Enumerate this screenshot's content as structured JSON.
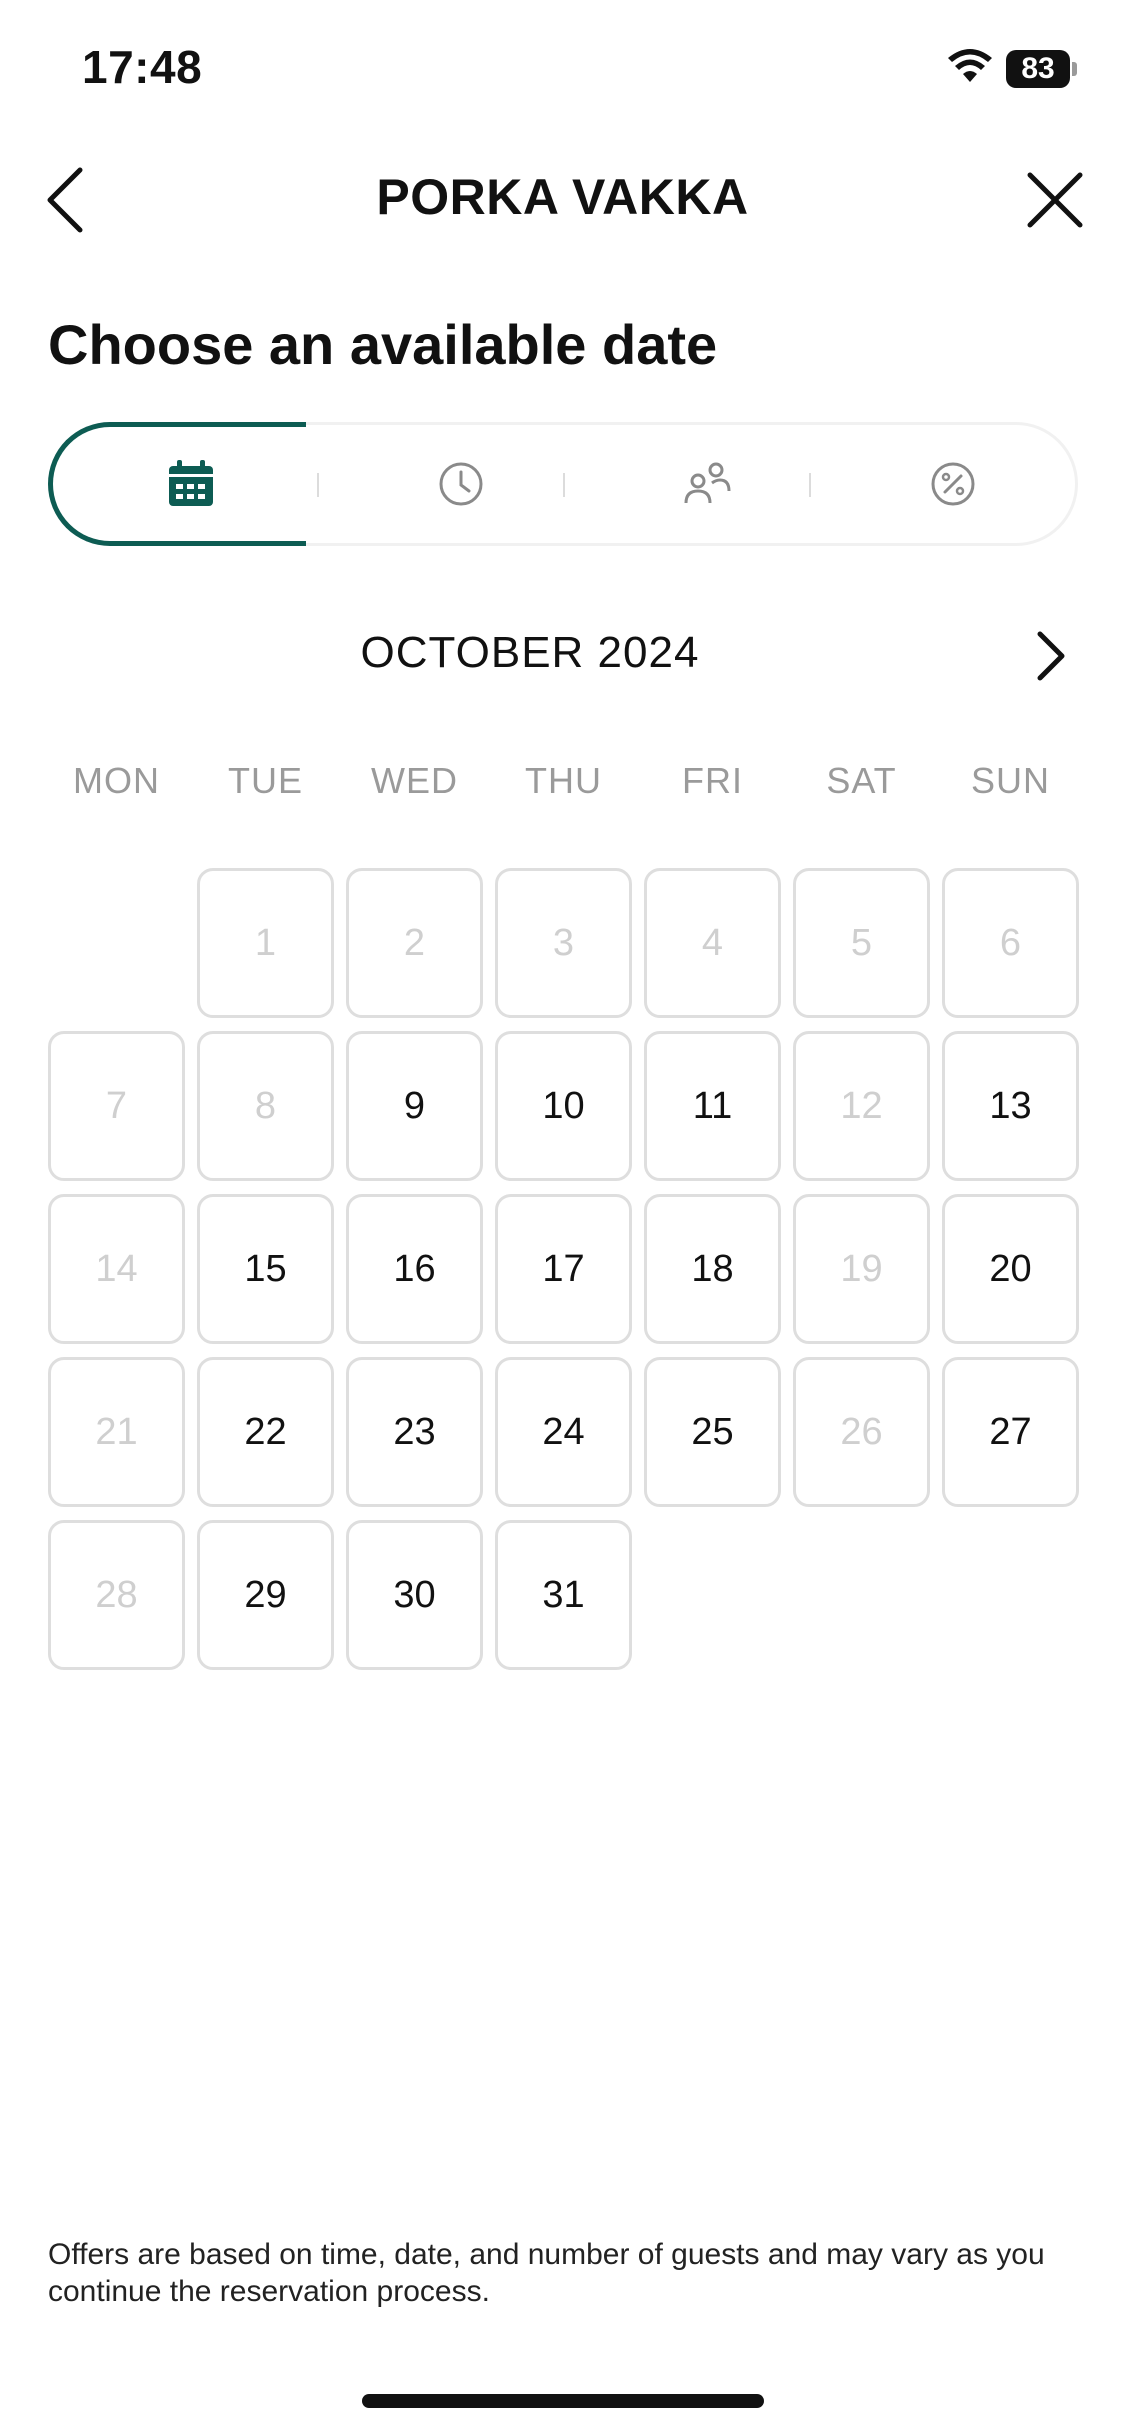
{
  "status_bar": {
    "time": "17:48",
    "battery": "83"
  },
  "header": {
    "title": "PORKA VAKKA"
  },
  "heading": "Choose an available date",
  "steps": [
    {
      "icon": "calendar-icon",
      "active": true
    },
    {
      "icon": "clock-icon",
      "active": false
    },
    {
      "icon": "guests-icon",
      "active": false
    },
    {
      "icon": "discount-icon",
      "active": false
    }
  ],
  "colors": {
    "accent": "#0d5c53",
    "border": "#dedede",
    "disabled": "#cfcfcf",
    "weekday": "#9a9a9a"
  },
  "calendar": {
    "month": "OCTOBER 2024",
    "weekdays": [
      "MON",
      "TUE",
      "WED",
      "THU",
      "FRI",
      "SAT",
      "SUN"
    ],
    "days": [
      {
        "day": "1",
        "available": false
      },
      {
        "day": "2",
        "available": false
      },
      {
        "day": "3",
        "available": false
      },
      {
        "day": "4",
        "available": false
      },
      {
        "day": "5",
        "available": false
      },
      {
        "day": "6",
        "available": false
      },
      {
        "day": "7",
        "available": false
      },
      {
        "day": "8",
        "available": false
      },
      {
        "day": "9",
        "available": true
      },
      {
        "day": "10",
        "available": true
      },
      {
        "day": "11",
        "available": true
      },
      {
        "day": "12",
        "available": false
      },
      {
        "day": "13",
        "available": true
      },
      {
        "day": "14",
        "available": false
      },
      {
        "day": "15",
        "available": true
      },
      {
        "day": "16",
        "available": true
      },
      {
        "day": "17",
        "available": true
      },
      {
        "day": "18",
        "available": true
      },
      {
        "day": "19",
        "available": false
      },
      {
        "day": "20",
        "available": true
      },
      {
        "day": "21",
        "available": false
      },
      {
        "day": "22",
        "available": true
      },
      {
        "day": "23",
        "available": true
      },
      {
        "day": "24",
        "available": true
      },
      {
        "day": "25",
        "available": true
      },
      {
        "day": "26",
        "available": false
      },
      {
        "day": "27",
        "available": true
      },
      {
        "day": "28",
        "available": false
      },
      {
        "day": "29",
        "available": true
      },
      {
        "day": "30",
        "available": true
      },
      {
        "day": "31",
        "available": true
      }
    ]
  },
  "footnote": "Offers are based on time, date, and number of guests and may vary as you continue the reservation process."
}
